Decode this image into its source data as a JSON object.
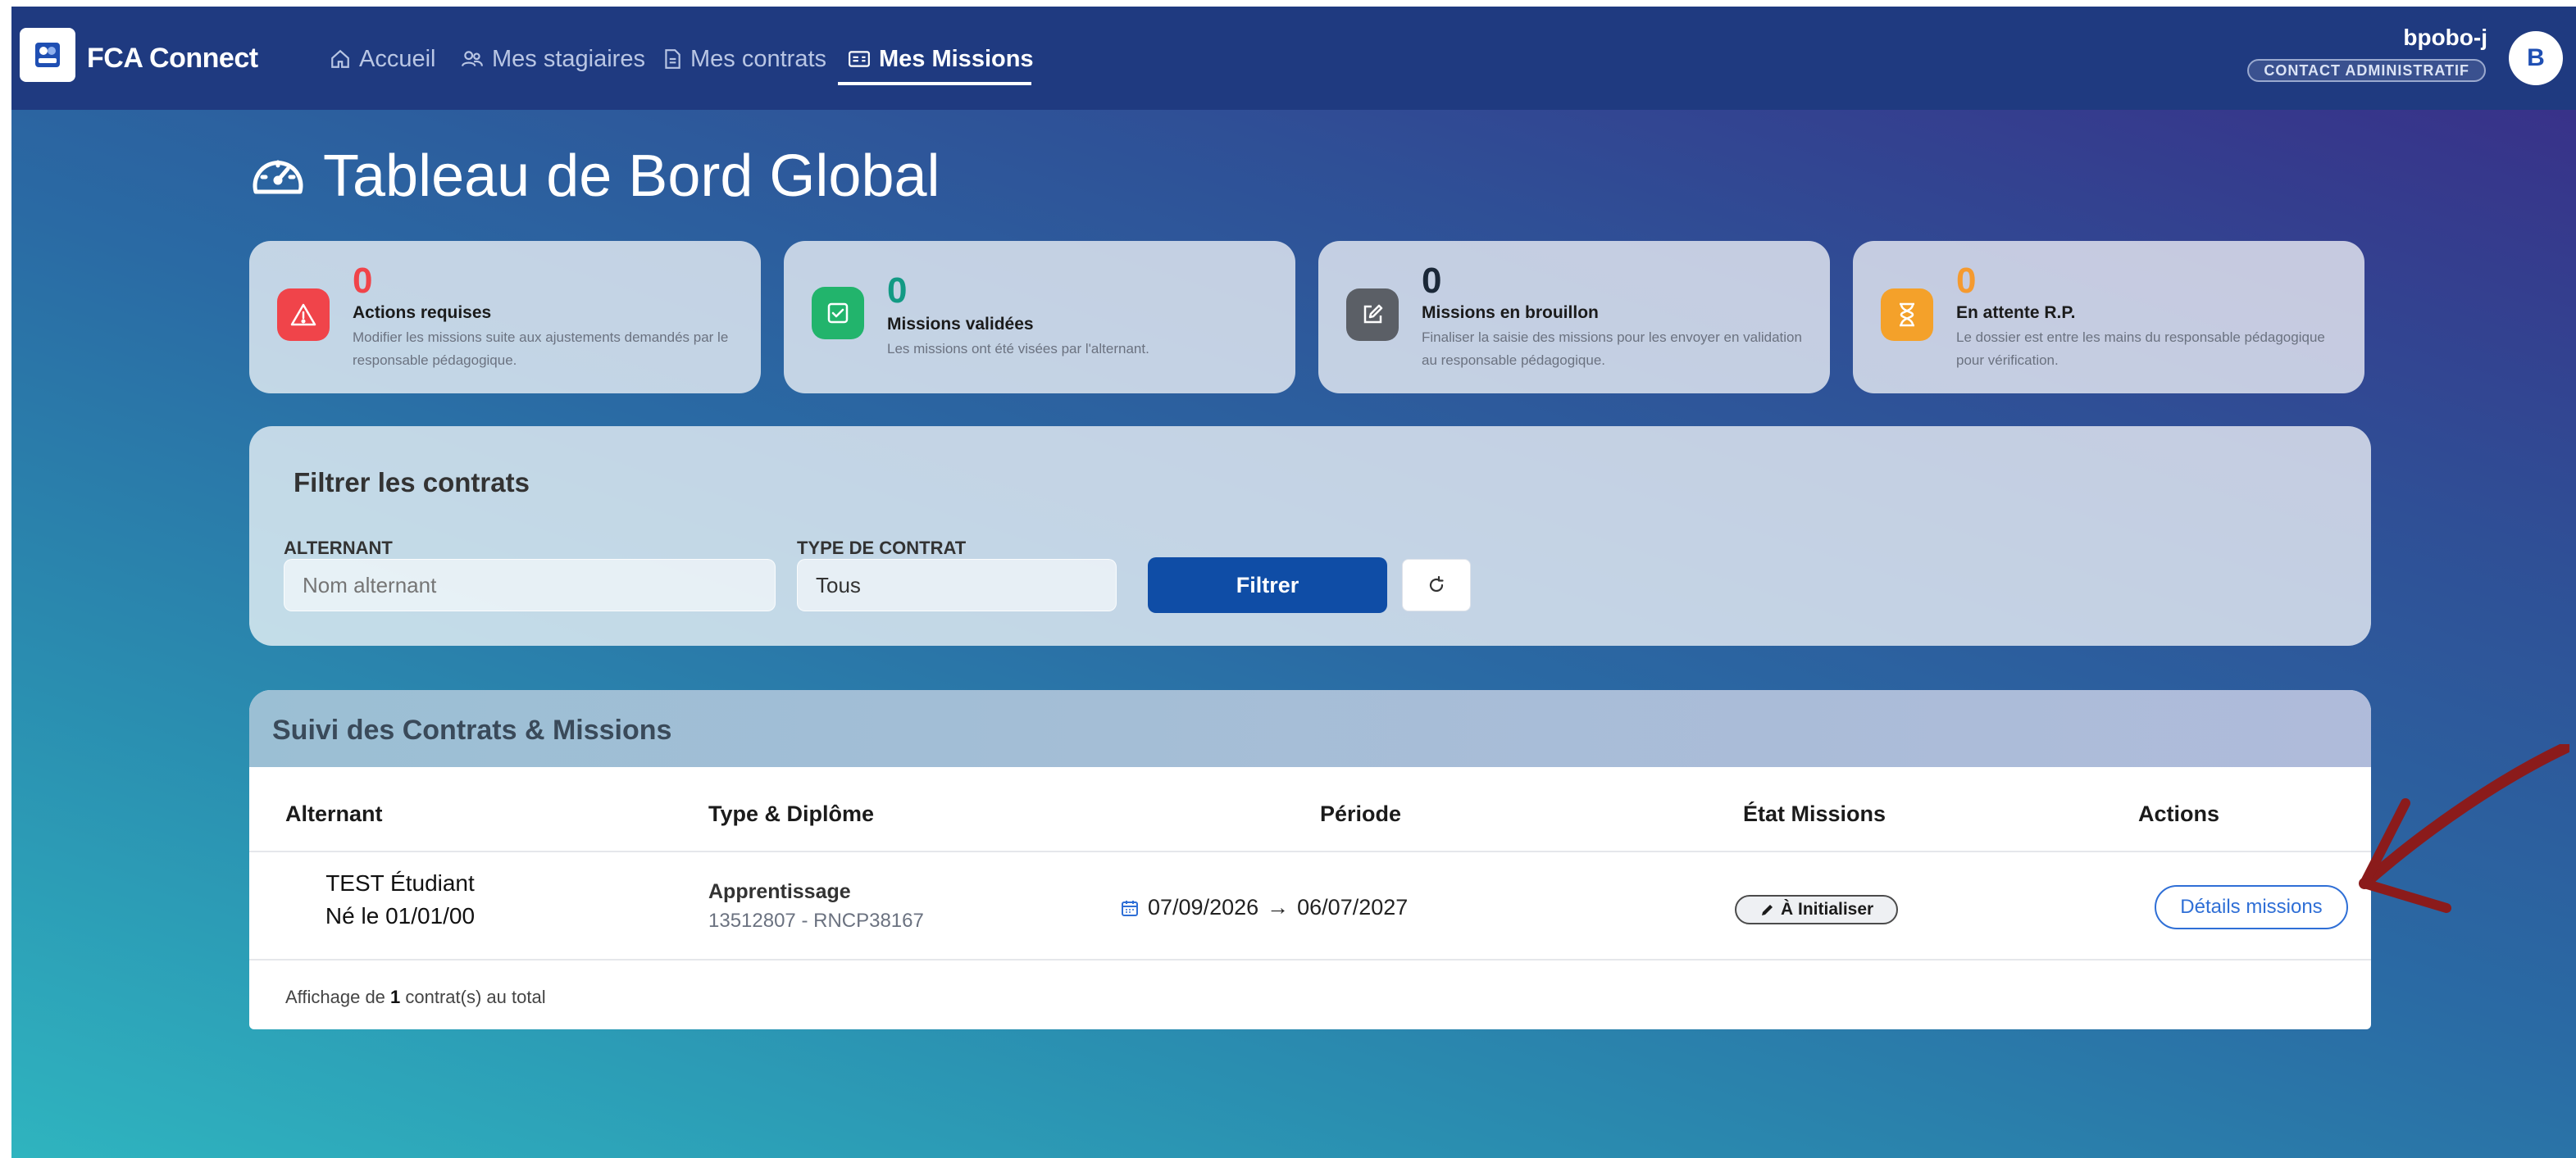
{
  "app": {
    "brand": "FCA Connect",
    "logo_icon": "fca-logo-icon"
  },
  "nav": {
    "items": [
      {
        "label": "Accueil",
        "icon": "home-icon",
        "active": false
      },
      {
        "label": "Mes stagiaires",
        "icon": "users-icon",
        "active": false
      },
      {
        "label": "Mes contrats",
        "icon": "document-icon",
        "active": false
      },
      {
        "label": "Mes Missions",
        "icon": "id-card-icon",
        "active": true
      }
    ]
  },
  "user": {
    "name": "bpobo-j",
    "role": "CONTACT ADMINISTRATIF",
    "avatar_initial": "B"
  },
  "page": {
    "title": "Tableau de Bord Global",
    "title_icon": "dashboard-gauge-icon"
  },
  "stats": [
    {
      "value": "0",
      "label": "Actions requises",
      "desc": "Modifier les missions suite aux ajustements demandés par le responsable pédagogique.",
      "icon": "warning-icon",
      "color": "#f0444a",
      "value_color": "#f0444a"
    },
    {
      "value": "0",
      "label": "Missions validées",
      "desc": "Les missions ont été visées par l'alternant.",
      "icon": "check-square-icon",
      "color": "#22b46c",
      "value_color": "#129a84"
    },
    {
      "value": "0",
      "label": "Missions en brouillon",
      "desc": "Finaliser la saisie des missions pour les envoyer en validation au responsable pédagogique.",
      "icon": "edit-icon",
      "color": "#5b5f66",
      "value_color": "#1b2838"
    },
    {
      "value": "0",
      "label": "En attente R.P.",
      "desc": "Le dossier est entre les mains du responsable pédagogique pour vérification.",
      "icon": "hourglass-icon",
      "color": "#f4a12a",
      "value_color": "#f59a2f"
    }
  ],
  "filter": {
    "title": "Filtrer les contrats",
    "alternant_label": "ALTERNANT",
    "alternant_placeholder": "Nom alternant",
    "type_label": "TYPE DE CONTRAT",
    "type_value": "Tous",
    "filter_button": "Filtrer",
    "reset_icon": "refresh-icon"
  },
  "table": {
    "title": "Suivi des Contrats & Missions",
    "columns": [
      "Alternant",
      "Type & Diplôme",
      "Période",
      "État Missions",
      "Actions"
    ],
    "rows": [
      {
        "name": "TEST Étudiant",
        "birth": "Né le 01/01/00",
        "type": "Apprentissage",
        "code": "13512807 - RNCP38167",
        "period_start": "07/09/2026",
        "period_arrow": "→",
        "period_end": "06/07/2027",
        "status": "À Initialiser",
        "status_icon": "pencil-icon",
        "action": "Détails missions"
      }
    ],
    "footer_prefix": "Affichage de ",
    "footer_count": "1",
    "footer_suffix": " contrat(s) au total"
  },
  "colors": {
    "navbar": "#1f3a80",
    "primary_button": "#0f4da6",
    "link_blue": "#2f6fd6",
    "annotation_arrow": "#8b1b1b"
  }
}
